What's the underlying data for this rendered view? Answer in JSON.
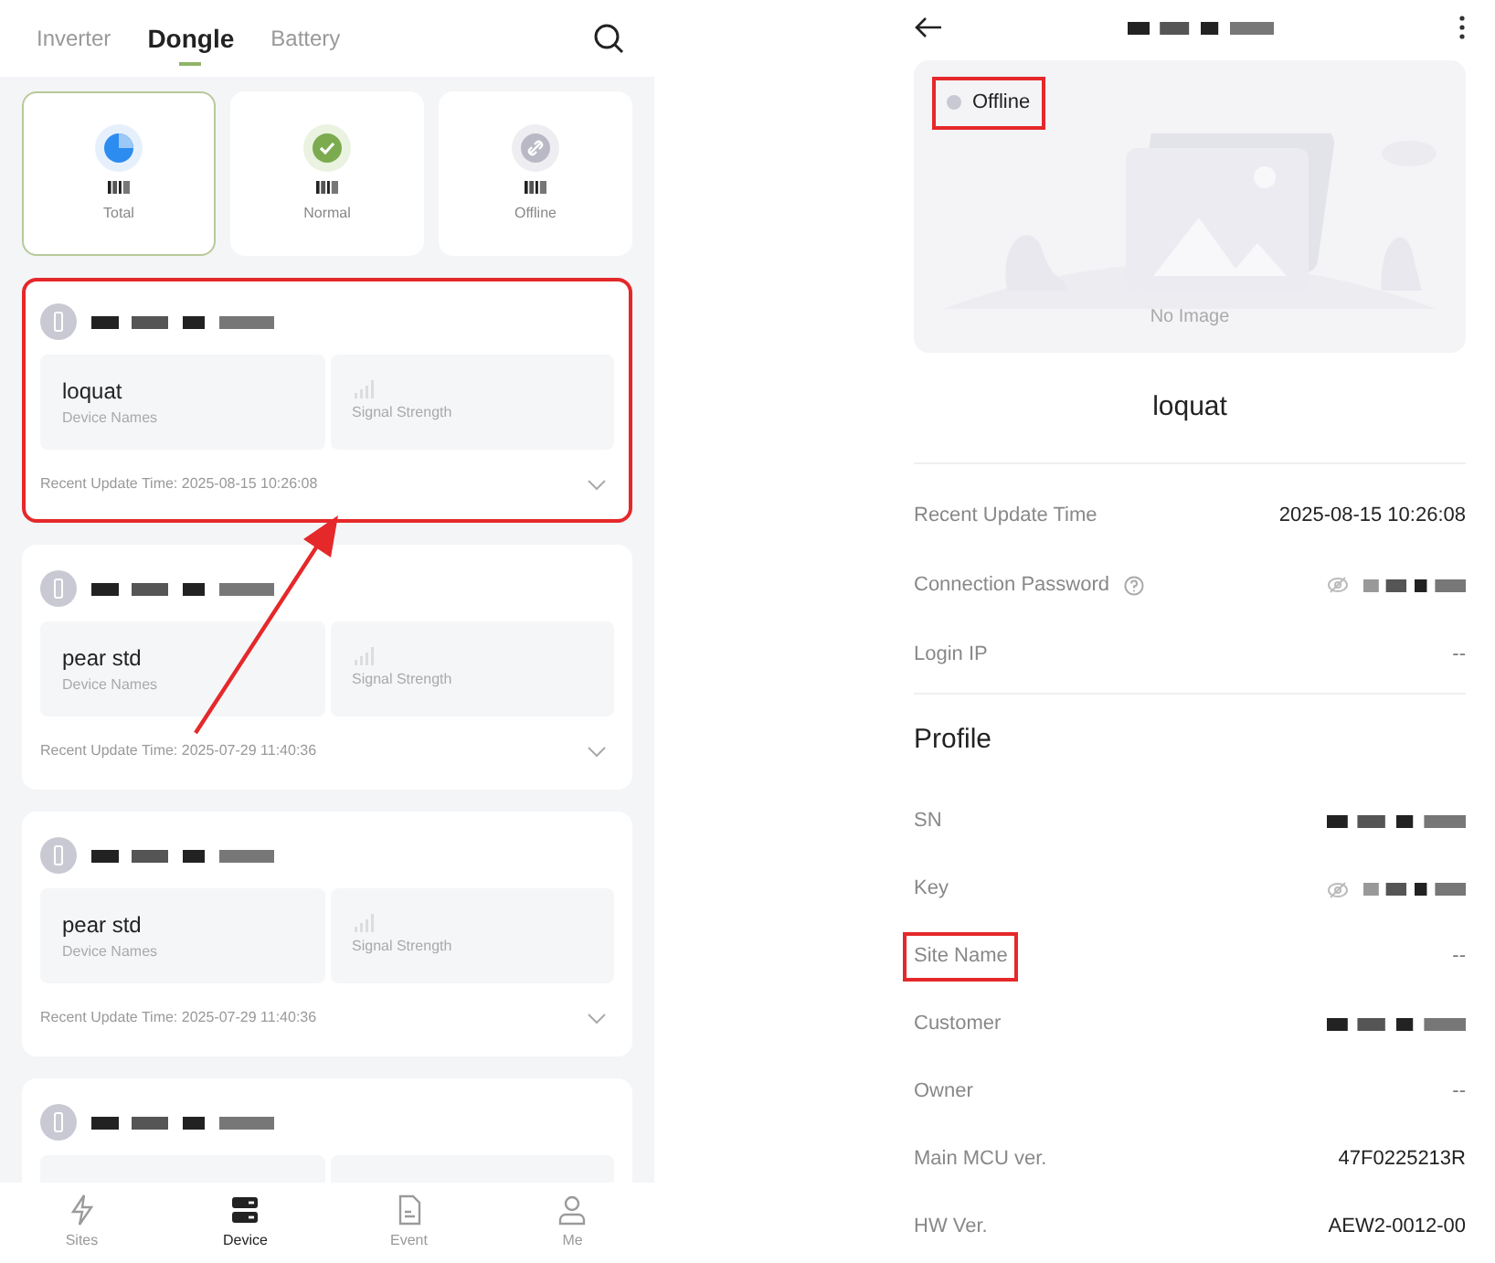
{
  "left": {
    "tabs": [
      {
        "label": "Inverter",
        "selected": false
      },
      {
        "label": "Dongle",
        "selected": true
      },
      {
        "label": "Battery",
        "selected": false
      }
    ],
    "stats": [
      {
        "label": "Total",
        "kind": "total",
        "selected": true
      },
      {
        "label": "Normal",
        "kind": "normal",
        "selected": false
      },
      {
        "label": "Offline",
        "kind": "offline",
        "selected": false
      }
    ],
    "devices": [
      {
        "kind": "full",
        "name": "loquat",
        "name_caption": "Device Names",
        "signal_caption": "Signal Strength",
        "update": "Recent Update Time: 2025-08-15 10:26:08",
        "highlighted": true
      },
      {
        "kind": "full",
        "name": "pear std",
        "name_caption": "Device Names",
        "signal_caption": "Signal Strength",
        "update": "Recent Update Time: 2025-07-29 11:40:36",
        "highlighted": false
      },
      {
        "kind": "full",
        "name": "pear std",
        "name_caption": "Device Names",
        "signal_caption": "Signal Strength",
        "update": "Recent Update Time: 2025-07-29 11:40:36",
        "highlighted": false
      },
      {
        "kind": "partial",
        "highlighted": false
      }
    ],
    "arrow_annotation": true,
    "nav": [
      {
        "label": "Sites",
        "kind": "sites",
        "selected": false
      },
      {
        "label": "Device",
        "kind": "device",
        "selected": true
      },
      {
        "label": "Event",
        "kind": "event",
        "selected": false
      },
      {
        "label": "Me",
        "kind": "me",
        "selected": false
      }
    ]
  },
  "right": {
    "status": {
      "label": "Offline",
      "highlighted": true
    },
    "image_caption": "No Image",
    "device_name": "loquat",
    "info_rows": [
      {
        "label": "Recent Update Time",
        "kind": "text",
        "value": "2025-08-15 10:26:08",
        "highlighted": false
      },
      {
        "label": "Connection Password",
        "kind": "secret",
        "help": true,
        "highlighted": false
      },
      {
        "label": "Login IP",
        "kind": "text",
        "value": "--",
        "highlighted": false
      }
    ],
    "profile_title": "Profile",
    "profile_rows": [
      {
        "label": "SN",
        "kind": "redacted",
        "highlighted": false
      },
      {
        "label": "Key",
        "kind": "secret",
        "highlighted": false
      },
      {
        "label": "Site Name",
        "kind": "text",
        "value": "--",
        "highlighted": true
      },
      {
        "label": "Customer",
        "kind": "redacted",
        "highlighted": false
      },
      {
        "label": "Owner",
        "kind": "text",
        "value": "--",
        "highlighted": false
      },
      {
        "label": "Main MCU ver.",
        "kind": "text",
        "value": "47F0225213R",
        "highlighted": false
      },
      {
        "label": "HW Ver.",
        "kind": "text",
        "value": "AEW2-0012-00",
        "highlighted": false
      }
    ]
  }
}
